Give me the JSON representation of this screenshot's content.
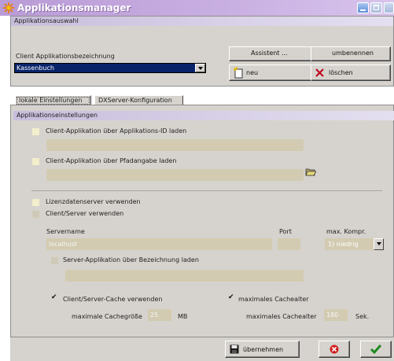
{
  "window": {
    "title": "Applikationsmanager"
  },
  "selection": {
    "group_label": "Applikationsauswahl",
    "client_label": "Client Applikationsbezeichnung",
    "client_value": "Kassenbuch",
    "assistant_button": "Assistent ...",
    "rename_button": "umbenennen",
    "new_button": "neu",
    "delete_button": "löschen"
  },
  "tabs": [
    {
      "label": "lokale Einstellungen",
      "active": true
    },
    {
      "label": "DXServer-Konfiguration",
      "active": false
    }
  ],
  "settings": {
    "header": "Applikationseinstellungen",
    "load_by_id": {
      "label": "Client-Applikation über Applikations-ID laden",
      "checked": false,
      "value": ""
    },
    "load_by_path": {
      "label": "Client-Applikation über Pfadangabe laden",
      "checked": false,
      "value": ""
    },
    "license_server": {
      "label": "Lizenzdatenserver verwenden",
      "checked": false
    },
    "client_server": {
      "label": "Client/Server verwenden",
      "checked": false
    },
    "servername_label": "Servername",
    "servername_value": "localhost",
    "port_label": "Port",
    "port_value": "",
    "compression_label": "max. Kompr.",
    "compression_value": "1) niedrig",
    "server_app_by_name": {
      "label": "Server-Applikation über Bezeichnung laden",
      "checked": false,
      "value": ""
    },
    "cache_use": {
      "label": "Client/Server-Cache verwenden",
      "checked": true
    },
    "max_cache_age_chk": {
      "label": "maximales Cachealter",
      "checked": true
    },
    "max_cache_size_label": "maximale Cachegröße",
    "max_cache_size_value": "25",
    "max_cache_size_unit": "MB",
    "max_cache_age_label": "maximales Cachealter",
    "max_cache_age_value": "180",
    "max_cache_age_unit": "Sek."
  },
  "footer": {
    "apply_button": "übernehmen",
    "cancel_icon": "cancel-icon",
    "ok_icon": "ok-check-icon"
  },
  "colors": {
    "title_gradient_start": "#b99bd6",
    "selection_blue": "#0a246a",
    "field_tan": "#d2cbb1"
  }
}
